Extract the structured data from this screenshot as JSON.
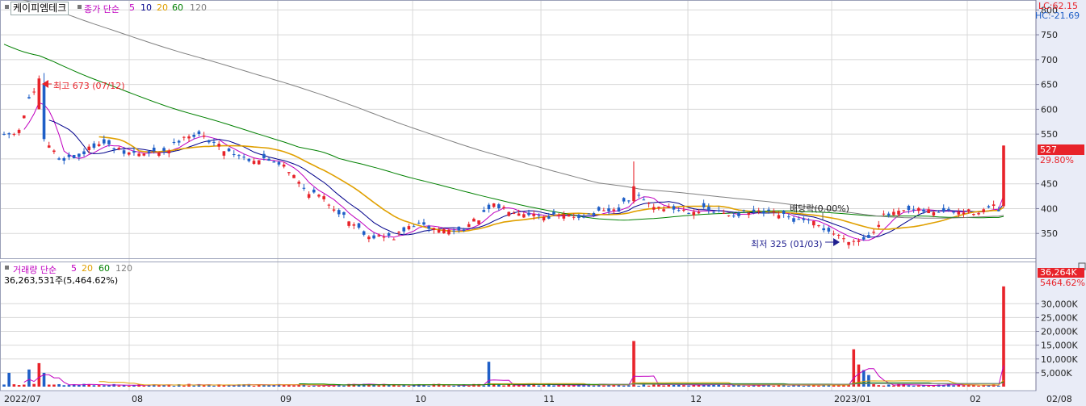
{
  "stock_name": "케이피엠테크",
  "price_legend": {
    "label": "종가 단순",
    "periods": [
      "5",
      "10",
      "20",
      "60",
      "120"
    ],
    "colors": [
      "#c000c0",
      "#00008b",
      "#e0a000",
      "#008000",
      "#808080"
    ]
  },
  "volume_legend": {
    "label": "거래량 단순",
    "periods": [
      "5",
      "20",
      "60",
      "120"
    ],
    "colors": [
      "#c000c0",
      "#e0a000",
      "#008000",
      "#808080"
    ]
  },
  "volume_summary": "36,263,531주(5,464.62%)",
  "corner_labels": {
    "lc": "LC:62.15",
    "hc": "HC:-21.69"
  },
  "last_price": {
    "price": "527",
    "change": "29.80%"
  },
  "last_volume": {
    "volume": "36,264K",
    "ratio": "5464.62%"
  },
  "annotations": {
    "high": "최고 673 (07/12)",
    "low": "최저 325 (01/03)",
    "dividend": "배당락(0.00%)"
  },
  "colors": {
    "up": "#e8232a",
    "down": "#1f5fc7",
    "grid": "#d8d8d8",
    "axis_bg": "#e9ecf7"
  },
  "chart_data": {
    "type": "candlestick",
    "x_labels": [
      "2022/07",
      "08",
      "09",
      "10",
      "11",
      "12",
      "2023/01",
      "02",
      "02/08"
    ],
    "price_axis": {
      "ticks": [
        350,
        400,
        450,
        500,
        550,
        600,
        650,
        700,
        750,
        800
      ],
      "tick_labels": [
        "350",
        "400",
        "450",
        "",
        "550",
        "600",
        "650",
        "700",
        "750",
        "800"
      ],
      "range": [
        300,
        820
      ]
    },
    "volume_axis": {
      "ticks": [
        5000,
        10000,
        15000,
        20000,
        25000,
        30000
      ],
      "tick_labels": [
        "5,000K",
        "10,000K",
        "15,000K",
        "20,000K",
        "25,000K",
        "30,000K"
      ],
      "range": [
        0,
        40000
      ],
      "unit": "K"
    },
    "close_anchors": [
      [
        0,
        545
      ],
      [
        3,
        555
      ],
      [
        5,
        622
      ],
      [
        7,
        638
      ],
      [
        8,
        542
      ],
      [
        11,
        500
      ],
      [
        15,
        505
      ],
      [
        19,
        535
      ],
      [
        24,
        512
      ],
      [
        29,
        510
      ],
      [
        33,
        520
      ],
      [
        36,
        548
      ],
      [
        40,
        545
      ],
      [
        44,
        520
      ],
      [
        49,
        500
      ],
      [
        53,
        498
      ],
      [
        56,
        490
      ],
      [
        60,
        440
      ],
      [
        64,
        420
      ],
      [
        68,
        385
      ],
      [
        73,
        345
      ],
      [
        78,
        342
      ],
      [
        82,
        368
      ],
      [
        87,
        358
      ],
      [
        91,
        355
      ],
      [
        95,
        380
      ],
      [
        98,
        405
      ],
      [
        103,
        395
      ],
      [
        108,
        385
      ],
      [
        114,
        385
      ],
      [
        119,
        390
      ],
      [
        123,
        398
      ],
      [
        126,
        430
      ],
      [
        130,
        405
      ],
      [
        136,
        397
      ],
      [
        140,
        397
      ],
      [
        145,
        388
      ],
      [
        150,
        392
      ],
      [
        155,
        388
      ],
      [
        158,
        377
      ],
      [
        162,
        370
      ],
      [
        167,
        345
      ],
      [
        171,
        332
      ],
      [
        173,
        345
      ],
      [
        176,
        385
      ],
      [
        181,
        395
      ],
      [
        186,
        395
      ],
      [
        191,
        392
      ],
      [
        195,
        395
      ],
      [
        198,
        403
      ],
      [
        199,
        397
      ],
      [
        200,
        527
      ]
    ],
    "special_days": [
      {
        "i": 7,
        "open": 600,
        "high": 668,
        "low": 600,
        "close": 662
      },
      {
        "i": 8,
        "open": 650,
        "high": 673,
        "low": 535,
        "close": 540
      },
      {
        "i": 126,
        "open": 415,
        "high": 495,
        "low": 410,
        "close": 445
      },
      {
        "i": 171,
        "open": 333,
        "high": 340,
        "low": 325,
        "close": 336
      },
      {
        "i": 200,
        "open": 405,
        "high": 527,
        "low": 402,
        "close": 527
      }
    ],
    "volume_spikes": [
      {
        "i": 1,
        "v": 5000
      },
      {
        "i": 5,
        "v": 6200
      },
      {
        "i": 7,
        "v": 8500
      },
      {
        "i": 8,
        "v": 5000
      },
      {
        "i": 97,
        "v": 9000
      },
      {
        "i": 126,
        "v": 16500
      },
      {
        "i": 170,
        "v": 13500
      },
      {
        "i": 171,
        "v": 8000
      },
      {
        "i": 172,
        "v": 6000
      },
      {
        "i": 173,
        "v": 4200
      },
      {
        "i": 200,
        "v": 36264
      }
    ],
    "ma_periods_price": [
      5,
      10,
      20,
      60,
      120
    ],
    "ma_periods_volume": [
      5,
      20,
      60,
      120
    ]
  }
}
